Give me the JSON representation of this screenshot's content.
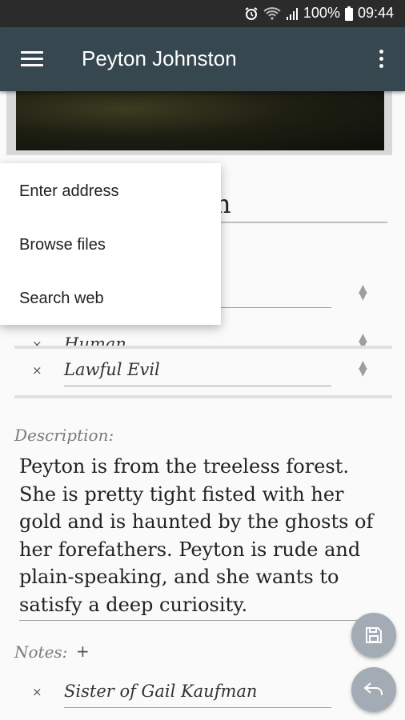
{
  "status_bar": {
    "battery": "100%",
    "time": "09:44",
    "icons": [
      "alarm-icon",
      "wifi-icon",
      "signal-icon",
      "battery-icon"
    ]
  },
  "app_bar": {
    "title": "Peyton Johnston",
    "icons": [
      "menu-icon",
      "more-vert-icon"
    ]
  },
  "header": {
    "name_visible_fragment": "n"
  },
  "tags": [
    {
      "label": "Human"
    },
    {
      "label": "Lawful Evil"
    }
  ],
  "description": {
    "label": "Description:",
    "text": "Peyton is from the treeless forest. She is pretty tight fisted with her gold and is haunted by the ghosts of her forefathers. Peyton is rude and plain-speaking, and she wants to satisfy a deep curiosity."
  },
  "notes": {
    "label": "Notes:",
    "add_label": "+",
    "items": [
      {
        "remove_label": "×",
        "text": "Sister of Gail Kaufman"
      }
    ]
  },
  "remove_label": "×",
  "image_menu": {
    "items": [
      {
        "label": "Enter address"
      },
      {
        "label": "Browse files"
      },
      {
        "label": "Search web"
      }
    ]
  },
  "fabs": [
    "save-icon",
    "undo-icon"
  ],
  "colors": {
    "app_bar": "#37474f",
    "status_bar": "#2b2b2b",
    "fab": "#a3acb4"
  }
}
